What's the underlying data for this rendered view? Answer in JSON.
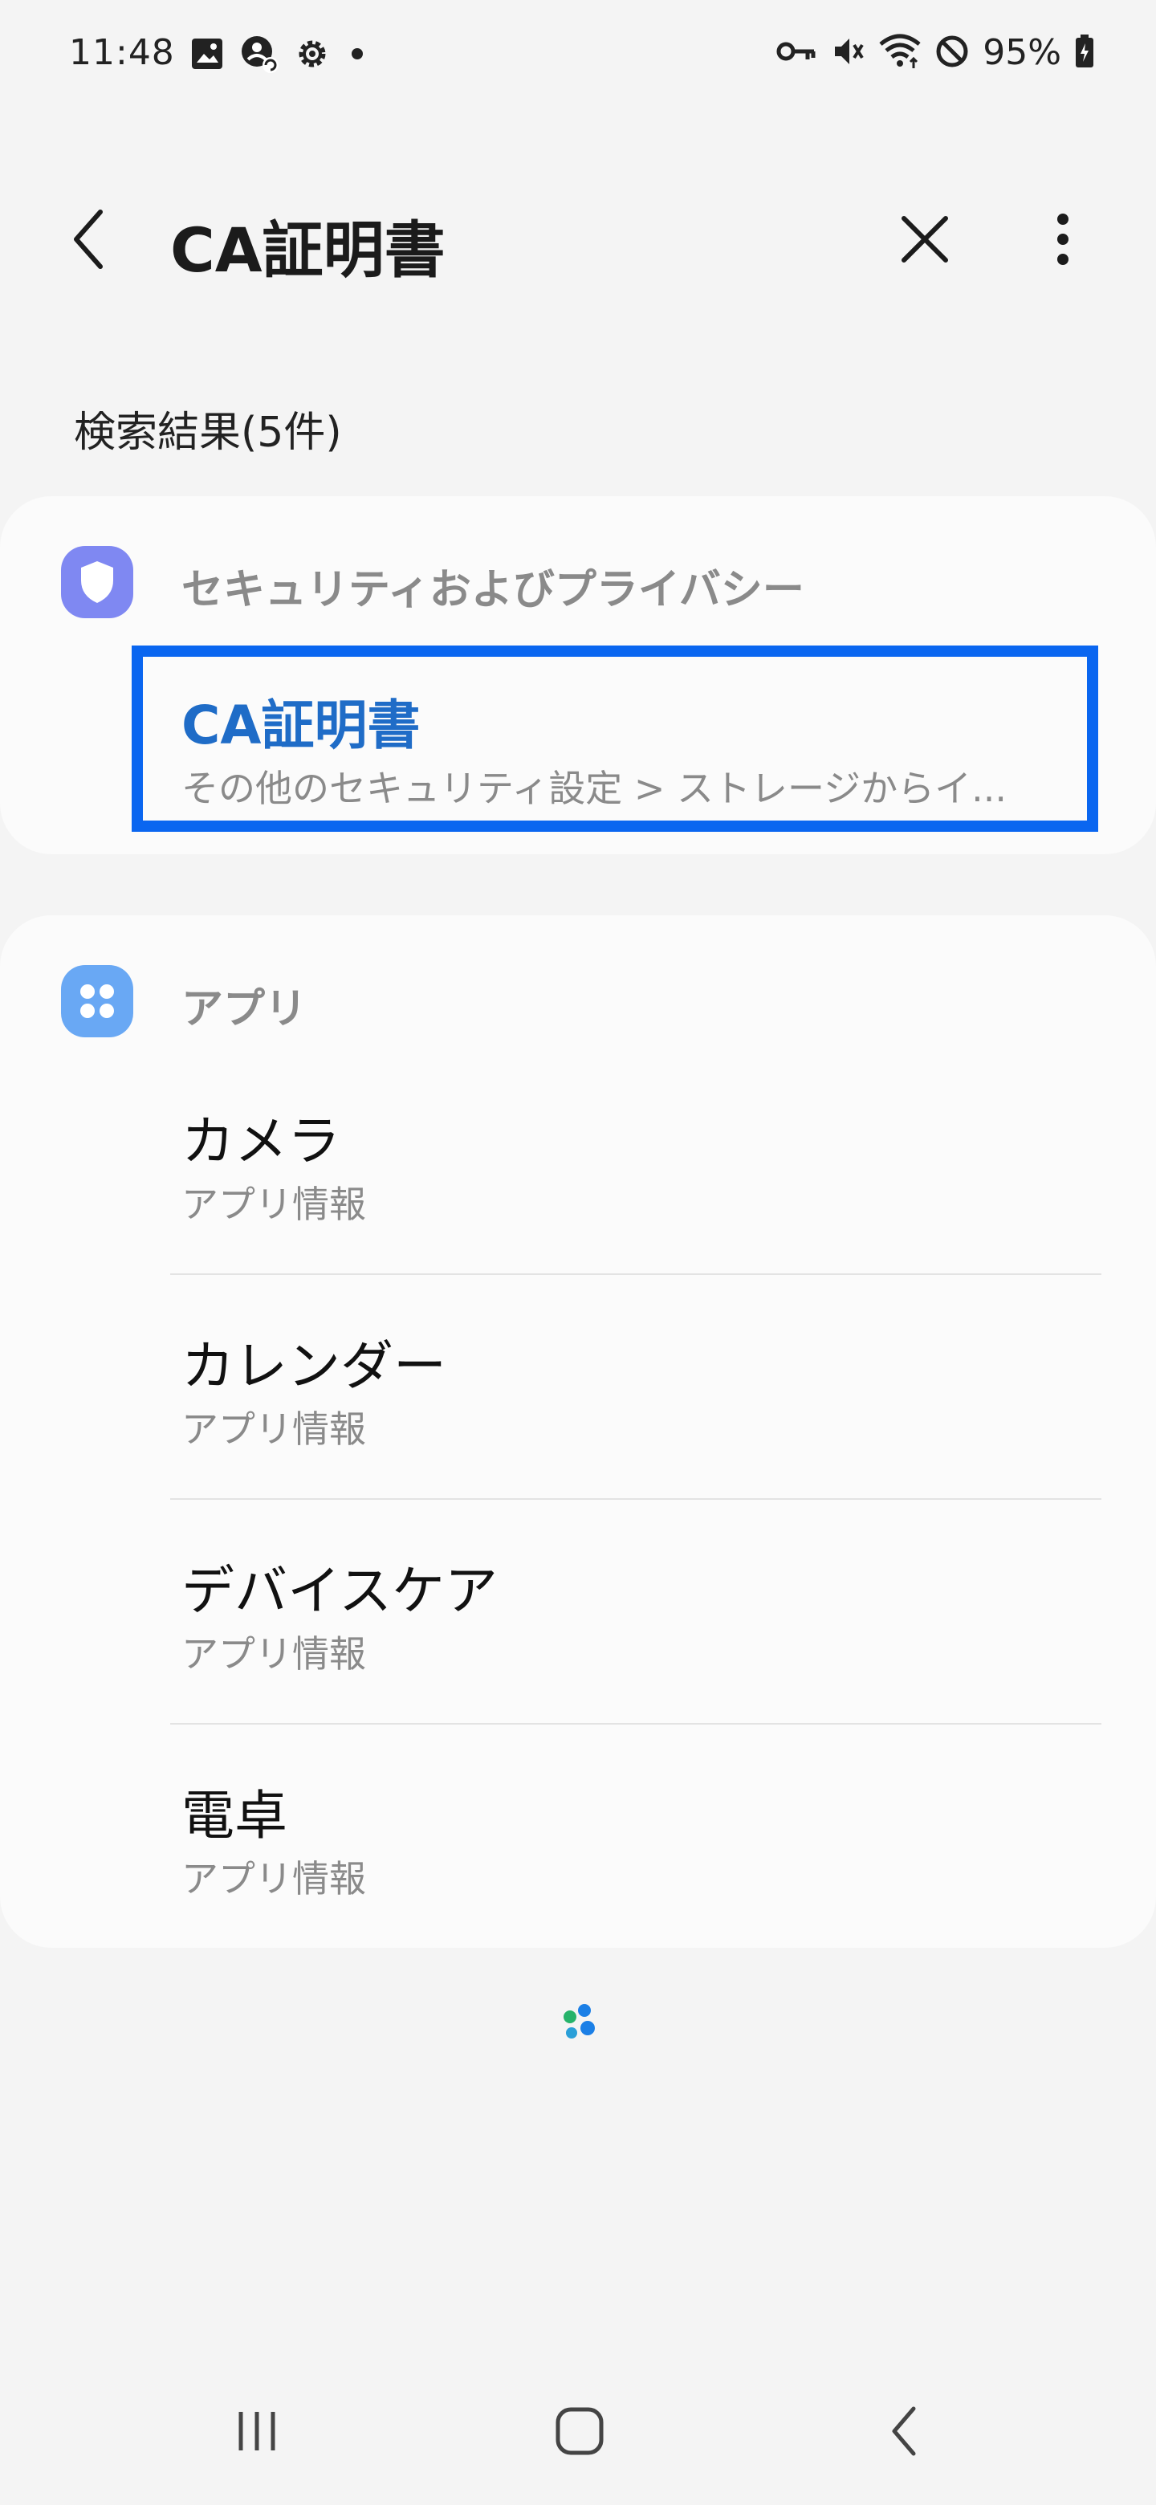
{
  "status_bar": {
    "time": "11:48",
    "battery": "95%",
    "left_icons": [
      "image-icon",
      "account-sync-icon",
      "gear-icon",
      "dot-icon"
    ],
    "right_icons": [
      "key-icon",
      "mute-icon",
      "wifi-icon",
      "block-icon",
      "battery-icon"
    ]
  },
  "header": {
    "title": "CA証明書",
    "back_icon": "back-chevron-icon",
    "close_icon": "close-icon",
    "more_icon": "more-vertical-icon"
  },
  "results": {
    "count_label": "検索結果(5件)"
  },
  "security_section": {
    "category": "セキュリティおよびプライバシー",
    "icon": "shield-icon",
    "icon_color": "#7f88f2",
    "item": {
      "title": "CA証明書",
      "path": "その他のセキュリティ設定 > ストレージからイ..."
    },
    "highlight_color": "#0a66f0",
    "title_color": "#1f6cc7"
  },
  "apps_section": {
    "category": "アプリ",
    "icon": "apps-icon",
    "icon_color": "#69a8f4",
    "items": [
      {
        "name": "カメラ",
        "sub": "アプリ情報"
      },
      {
        "name": "カレンダー",
        "sub": "アプリ情報"
      },
      {
        "name": "デバイスケア",
        "sub": "アプリ情報"
      },
      {
        "name": "電卓",
        "sub": "アプリ情報"
      }
    ]
  },
  "nav_bar": {
    "recent_icon": "recent-apps-icon",
    "home_icon": "home-icon",
    "back_icon": "nav-back-icon"
  }
}
